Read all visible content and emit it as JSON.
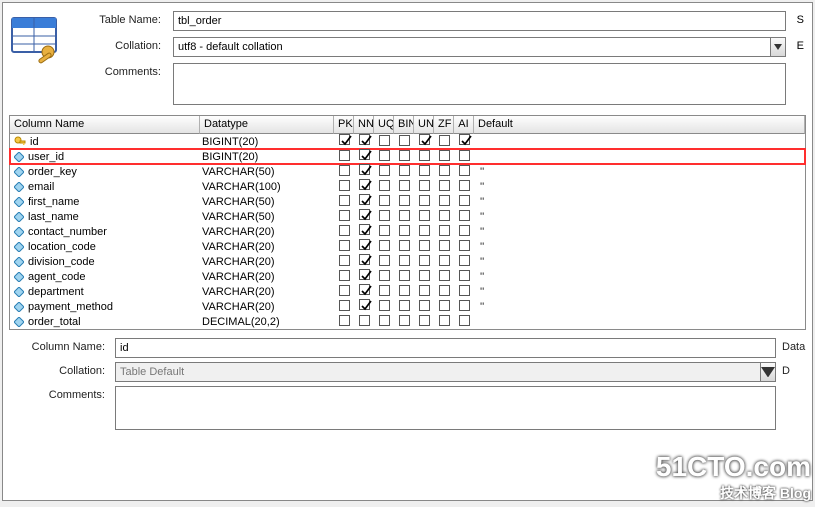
{
  "labels": {
    "table_name": "Table Name:",
    "collation": "Collation:",
    "comments": "Comments:",
    "column_name_header": "Column Name",
    "datatype_header": "Datatype",
    "pk": "PK",
    "nn": "NN",
    "uq": "UQ",
    "bin": "BIN",
    "un": "UN",
    "zf": "ZF",
    "ai": "AI",
    "default": "Default",
    "b_column_name": "Column Name:",
    "b_collation": "Collation:",
    "b_comments": "Comments:",
    "b_data": "Data",
    "b_d": "D",
    "side_s": "S",
    "side_e": "E"
  },
  "values": {
    "table_name": "tbl_order",
    "collation": "utf8 - default collation",
    "comments": "",
    "b_column_name": "id",
    "b_collation": "Table Default",
    "b_comments": ""
  },
  "columns": [
    {
      "icon": "key",
      "name": "id",
      "datatype": "BIGINT(20)",
      "pk": true,
      "nn": true,
      "uq": false,
      "bin": false,
      "un": true,
      "zf": false,
      "ai": true,
      "default": ""
    },
    {
      "icon": "diamond",
      "name": "user_id",
      "datatype": "BIGINT(20)",
      "pk": false,
      "nn": true,
      "uq": false,
      "bin": false,
      "un": false,
      "zf": false,
      "ai": false,
      "default": "",
      "highlight": true
    },
    {
      "icon": "diamond",
      "name": "order_key",
      "datatype": "VARCHAR(50)",
      "pk": false,
      "nn": true,
      "uq": false,
      "bin": false,
      "un": false,
      "zf": false,
      "ai": false,
      "default": "''"
    },
    {
      "icon": "diamond",
      "name": "email",
      "datatype": "VARCHAR(100)",
      "pk": false,
      "nn": true,
      "uq": false,
      "bin": false,
      "un": false,
      "zf": false,
      "ai": false,
      "default": "''"
    },
    {
      "icon": "diamond",
      "name": "first_name",
      "datatype": "VARCHAR(50)",
      "pk": false,
      "nn": true,
      "uq": false,
      "bin": false,
      "un": false,
      "zf": false,
      "ai": false,
      "default": "''"
    },
    {
      "icon": "diamond",
      "name": "last_name",
      "datatype": "VARCHAR(50)",
      "pk": false,
      "nn": true,
      "uq": false,
      "bin": false,
      "un": false,
      "zf": false,
      "ai": false,
      "default": "''"
    },
    {
      "icon": "diamond",
      "name": "contact_number",
      "datatype": "VARCHAR(20)",
      "pk": false,
      "nn": true,
      "uq": false,
      "bin": false,
      "un": false,
      "zf": false,
      "ai": false,
      "default": "''"
    },
    {
      "icon": "diamond",
      "name": "location_code",
      "datatype": "VARCHAR(20)",
      "pk": false,
      "nn": true,
      "uq": false,
      "bin": false,
      "un": false,
      "zf": false,
      "ai": false,
      "default": "''"
    },
    {
      "icon": "diamond",
      "name": "division_code",
      "datatype": "VARCHAR(20)",
      "pk": false,
      "nn": true,
      "uq": false,
      "bin": false,
      "un": false,
      "zf": false,
      "ai": false,
      "default": "''"
    },
    {
      "icon": "diamond",
      "name": "agent_code",
      "datatype": "VARCHAR(20)",
      "pk": false,
      "nn": true,
      "uq": false,
      "bin": false,
      "un": false,
      "zf": false,
      "ai": false,
      "default": "''"
    },
    {
      "icon": "diamond",
      "name": "department",
      "datatype": "VARCHAR(20)",
      "pk": false,
      "nn": true,
      "uq": false,
      "bin": false,
      "un": false,
      "zf": false,
      "ai": false,
      "default": "''"
    },
    {
      "icon": "diamond",
      "name": "payment_method",
      "datatype": "VARCHAR(20)",
      "pk": false,
      "nn": true,
      "uq": false,
      "bin": false,
      "un": false,
      "zf": false,
      "ai": false,
      "default": "''"
    },
    {
      "icon": "diamond",
      "name": "order_total",
      "datatype": "DECIMAL(20,2)",
      "pk": false,
      "nn": false,
      "uq": false,
      "bin": false,
      "un": false,
      "zf": false,
      "ai": false,
      "default": ""
    }
  ],
  "watermark": {
    "big": "51CTO.com",
    "small": "技术博客   Blog"
  }
}
